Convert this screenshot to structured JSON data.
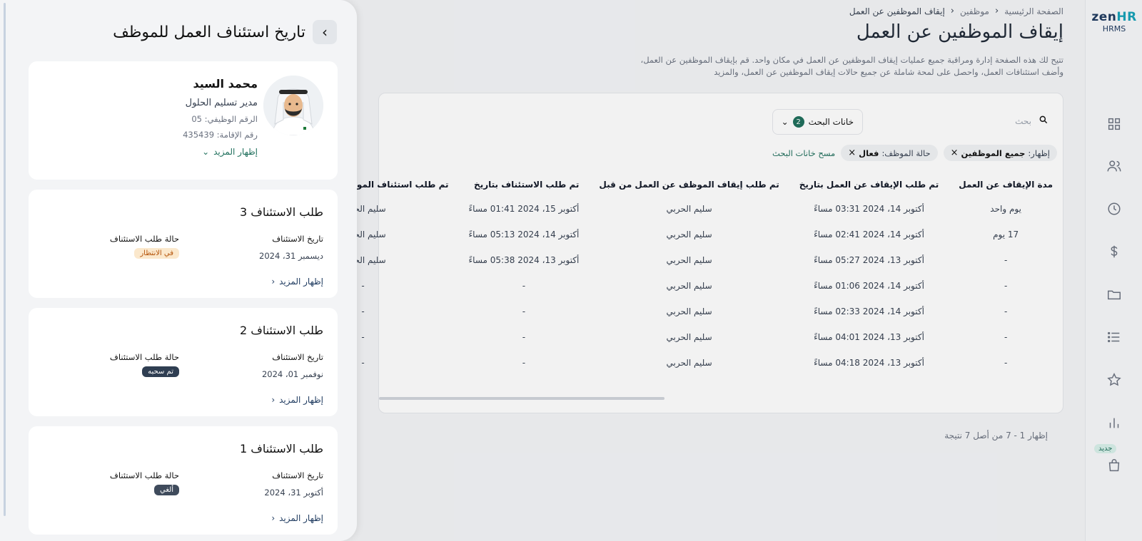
{
  "sidebar": {
    "logo_text": "zen",
    "logo_accent": "HR",
    "logo_sub": "HRMS",
    "new_badge": "جديد",
    "icons": [
      "grid-icon",
      "users-icon",
      "clock-icon",
      "dollar-icon",
      "folder-icon",
      "list-icon",
      "star-icon",
      "bar-chart-icon",
      "shopping-bag-icon"
    ]
  },
  "breadcrumb": {
    "home": "الصفحة الرئيسية",
    "employees": "موظفين",
    "current": "إيقاف الموظفين عن العمل"
  },
  "page": {
    "title": "إيقاف الموظفين عن العمل",
    "description": "تتيح لك هذه الصفحة إدارة ومراقبة جميع عمليات إيقاف الموظفين عن العمل في مكان واحد. قم بإيقاف الموظفين عن العمل، وأضف استئنافات العمل، واحصل على لمحة شاملة عن جميع حالات إيقاف الموظفين عن العمل، والمزيد"
  },
  "search": {
    "placeholder": "بحث"
  },
  "filters": {
    "button_label": "خانات البحث",
    "count": "2",
    "chip1_key": "إظهار:",
    "chip1_value": "جميع الموظفين",
    "chip2_key": "حالة الموظف:",
    "chip2_value": "فعال",
    "clear": "مسح خانات البحث"
  },
  "table": {
    "headers": [
      "مدة الإيقاف عن العمل",
      "تم طلب الإيقاف عن العمل بتاريخ",
      "تم طلب إيقاف الموظف عن العمل من قبل",
      "تم طلب الاستئناف بتاريخ",
      "تم طلب استئناف الموظف لعمله من قبل"
    ],
    "rows": [
      [
        "يوم واحد",
        "أكتوبر 14، 2024 03:31 مساءً",
        "سليم الحربي",
        "أكتوبر 15، 2024 01:41 مساءً",
        "سليم الحربي"
      ],
      [
        "17 يوم",
        "أكتوبر 14، 2024 02:41 مساءً",
        "سليم الحربي",
        "أكتوبر 14، 2024 05:13 مساءً",
        "سليم الحربي"
      ],
      [
        "-",
        "أكتوبر 13، 2024 05:27 مساءً",
        "سليم الحربي",
        "أكتوبر 13، 2024 05:38 مساءً",
        "سليم الحربي"
      ],
      [
        "-",
        "أكتوبر 14، 2024 01:06 مساءً",
        "سليم الحربي",
        "-",
        "-"
      ],
      [
        "-",
        "أكتوبر 14، 2024 02:33 مساءً",
        "سليم الحربي",
        "-",
        "-"
      ],
      [
        "-",
        "أكتوبر 13، 2024 04:01 مساءً",
        "سليم الحربي",
        "-",
        "-"
      ],
      [
        "-",
        "أكتوبر 13، 2024 04:18 مساءً",
        "سليم الحربي",
        "-",
        "-"
      ]
    ],
    "count_text": "إظهار 1 - 7 من أصل 7 نتيجة"
  },
  "drawer": {
    "title": "تاريخ استئناف العمل للموظف",
    "employee": {
      "name": "محمد السيد",
      "role": "مدير تسليم الحلول",
      "id": "الرقم الوظيفي: 05",
      "residence": "رقم الإقامة: 435439",
      "show_more": "إظهار المزيد"
    },
    "requests": [
      {
        "title": "طلب الاستئناف 3",
        "date_label": "تاريخ الاستئناف",
        "date": "ديسمبر 31، 2024",
        "status_label": "حالة طلب الاستئناف",
        "status": "في الانتظار",
        "show_more": "إظهار المزيد"
      },
      {
        "title": "طلب الاستئناف 2",
        "date_label": "تاريخ الاستئناف",
        "date": "نوفمبر 01، 2024",
        "status_label": "حالة طلب الاستئناف",
        "status": "تم سحبه",
        "show_more": "إظهار المزيد"
      },
      {
        "title": "طلب الاستئناف 1",
        "date_label": "تاريخ الاستئناف",
        "date": "أكتوبر 31، 2024",
        "status_label": "حالة طلب الاستئناف",
        "status": "ألغي",
        "show_more": "إظهار المزيد"
      }
    ]
  },
  "colors": {
    "accent": "#1f6f5c",
    "pending_bg": "#fbe8cc",
    "withdrawn_bg": "#2f3e52"
  }
}
